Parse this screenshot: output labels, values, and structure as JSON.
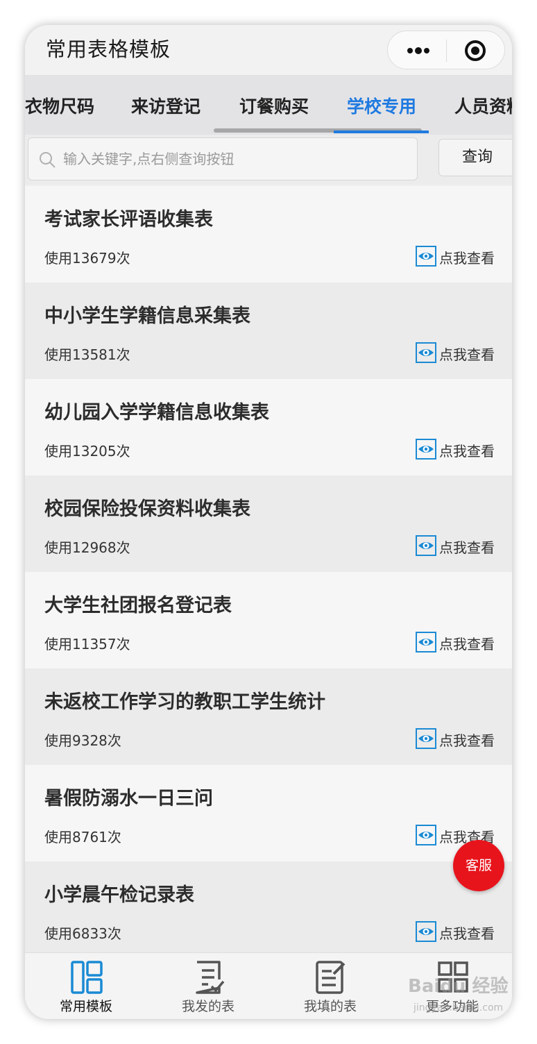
{
  "navbar": {
    "title": "常用表格模板"
  },
  "tabs": [
    {
      "label": "衣物尺码",
      "active": false
    },
    {
      "label": "来访登记",
      "active": false
    },
    {
      "label": "订餐购买",
      "active": false
    },
    {
      "label": "学校专用",
      "active": true
    },
    {
      "label": "人员资料",
      "active": false
    }
  ],
  "search": {
    "placeholder": "输入关键字,点右侧查询按钮",
    "button_label": "查询"
  },
  "templates": [
    {
      "title": "考试家长评语收集表",
      "usage": "使用13679次",
      "view_label": "点我查看"
    },
    {
      "title": "中小学生学籍信息采集表",
      "usage": "使用13581次",
      "view_label": "点我查看"
    },
    {
      "title": "幼儿园入学学籍信息收集表",
      "usage": "使用13205次",
      "view_label": "点我查看"
    },
    {
      "title": "校园保险投保资料收集表",
      "usage": "使用12968次",
      "view_label": "点我查看"
    },
    {
      "title": "大学生社团报名登记表",
      "usage": "使用11357次",
      "view_label": "点我查看"
    },
    {
      "title": "未返校工作学习的教职工学生统计",
      "usage": "使用9328次",
      "view_label": "点我查看"
    },
    {
      "title": "暑假防溺水一日三问",
      "usage": "使用8761次",
      "view_label": "点我查看"
    },
    {
      "title": "小学晨午检记录表",
      "usage": "使用6833次",
      "view_label": "点我查看"
    }
  ],
  "service_button": {
    "label": "客服"
  },
  "bottom_tabs": [
    {
      "label": "常用模板",
      "icon": "template-grid-icon",
      "active": true
    },
    {
      "label": "我发的表",
      "icon": "form-check-icon",
      "active": false
    },
    {
      "label": "我填的表",
      "icon": "form-edit-icon",
      "active": false
    },
    {
      "label": "更多功能",
      "icon": "apps-grid-icon",
      "active": false
    }
  ],
  "watermark": {
    "text": "Baidu 经验",
    "sub": "jingyan.baidu.com"
  },
  "colors": {
    "accent": "#1f7ae0",
    "service": "#e8141c",
    "text": "#2c2c2c"
  }
}
